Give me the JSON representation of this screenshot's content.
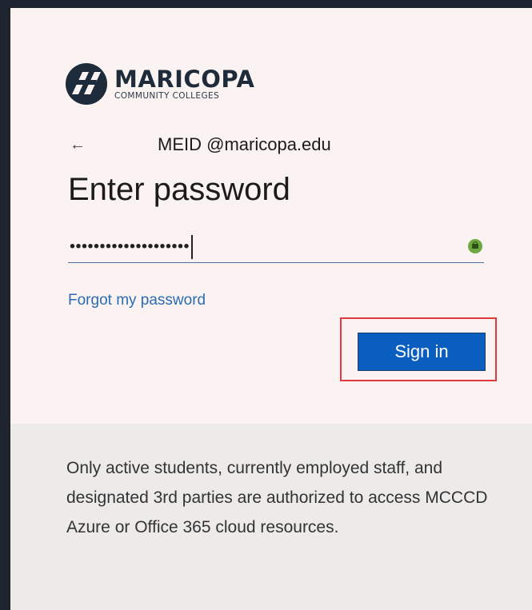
{
  "logo": {
    "name": "MARICOPA",
    "subtitle": "COMMUNITY COLLEGES",
    "colors": {
      "mark": "#1d2b3a"
    }
  },
  "account": {
    "back_icon": "back-arrow-icon",
    "email": "MEID @maricopa.edu"
  },
  "heading": "Enter password",
  "password": {
    "value": "••••••••••••••••••••",
    "icon": "lock-icon"
  },
  "forgot_link": "Forgot my password",
  "signin_button": "Sign in",
  "notice": "Only active students, currently employed staff, and designated 3rd parties are authorized to access MCCCD Azure or Office 365 cloud resources.",
  "colors": {
    "primary": "#0a5ebf",
    "link": "#2a6bb3",
    "highlight": "#e0393e",
    "background": "#fbf3f1",
    "footer_background": "#ecebe9"
  }
}
